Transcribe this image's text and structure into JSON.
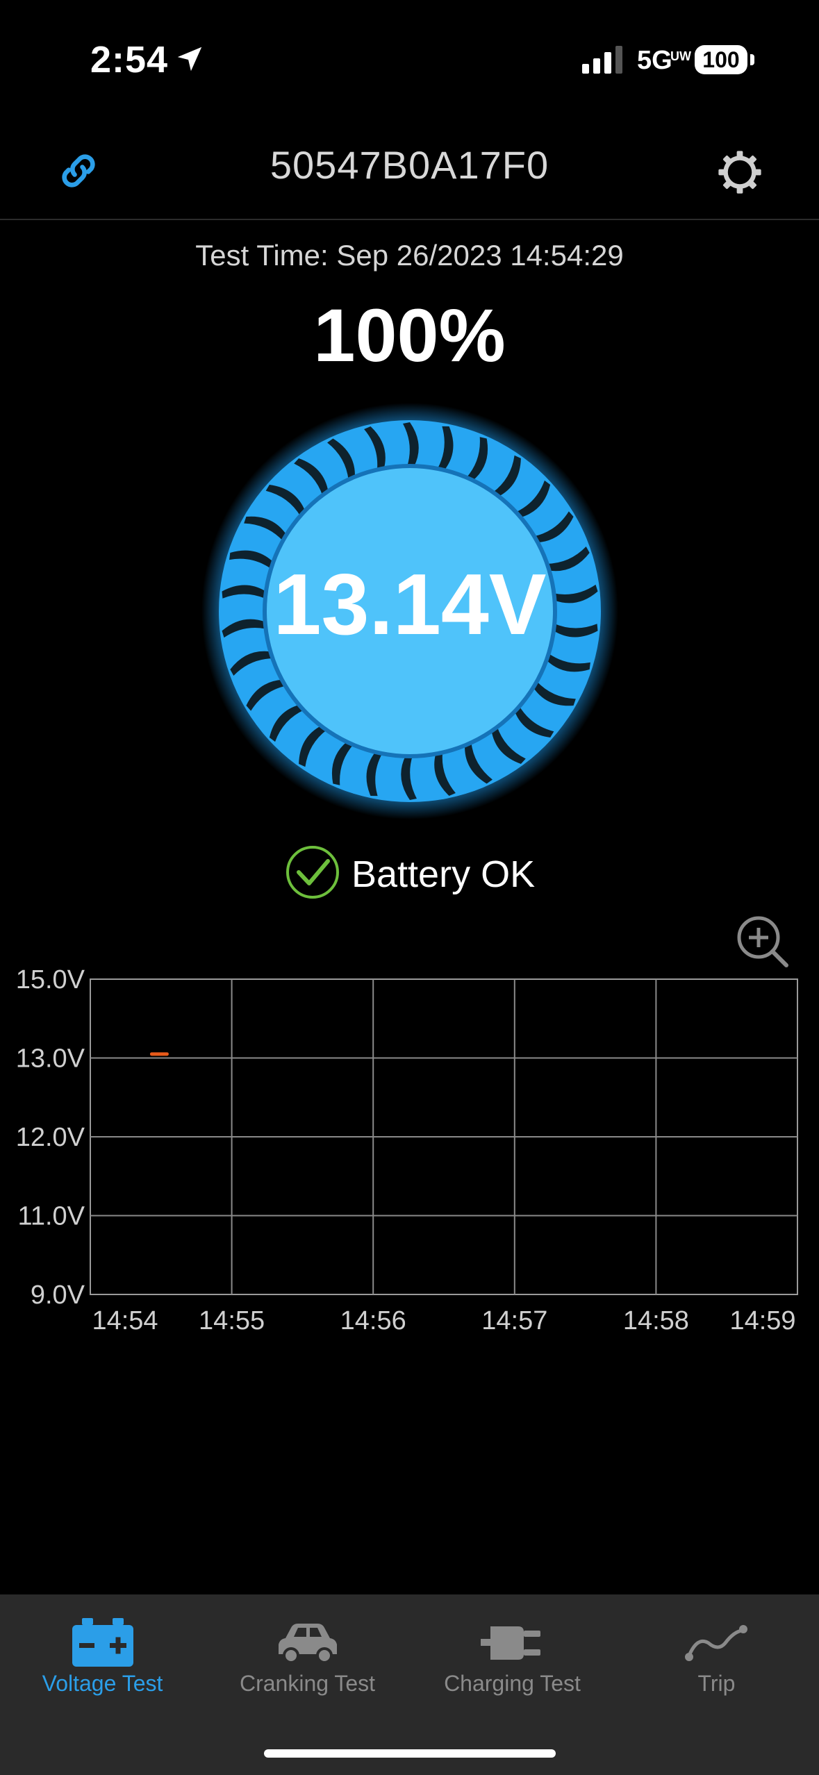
{
  "status_bar": {
    "time": "2:54",
    "network": "5G",
    "network_sub": "UW",
    "battery": "100"
  },
  "header": {
    "device_id": "50547B0A17F0",
    "link_icon": "link-icon",
    "settings_icon": "gear-icon"
  },
  "test_time_label": "Test Time:  Sep 26/2023 14:54:29",
  "charge_percent": "100%",
  "voltage": "13.14V",
  "battery_status": "Battery OK",
  "colors": {
    "accent": "#2b9ee8",
    "gauge_fill": "#4fc3fa",
    "ok_green": "#6dbf3c",
    "trace": "#e85a1a"
  },
  "chart_data": {
    "type": "line",
    "y_ticks": [
      "15.0V",
      "13.0V",
      "12.0V",
      "11.0V",
      "9.0V"
    ],
    "x_ticks": [
      "14:54",
      "14:55",
      "14:56",
      "14:57",
      "14:58",
      "14:59"
    ],
    "series": [
      {
        "x": [
          "14:54:29"
        ],
        "y": [
          13.1
        ]
      }
    ],
    "grid": true
  },
  "tabs": [
    {
      "label": "Voltage Test",
      "icon": "battery-icon",
      "active": true
    },
    {
      "label": "Cranking Test",
      "icon": "car-icon",
      "active": false
    },
    {
      "label": "Charging Test",
      "icon": "plug-icon",
      "active": false
    },
    {
      "label": "Trip",
      "icon": "trip-curve-icon",
      "active": false
    }
  ]
}
